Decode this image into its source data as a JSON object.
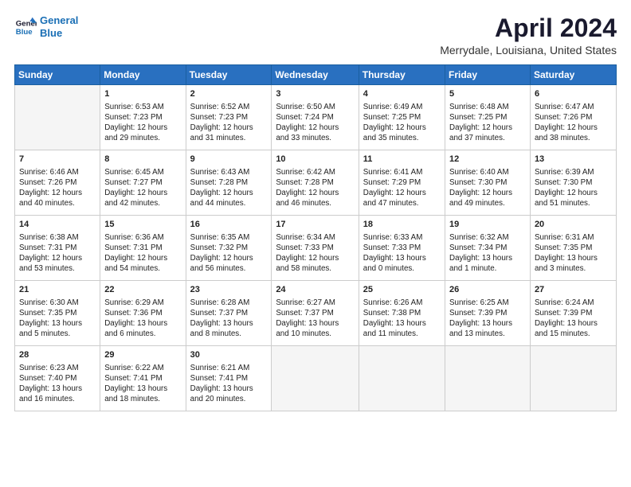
{
  "header": {
    "logo_line1": "General",
    "logo_line2": "Blue",
    "title": "April 2024",
    "subtitle": "Merrydale, Louisiana, United States"
  },
  "weekdays": [
    "Sunday",
    "Monday",
    "Tuesday",
    "Wednesday",
    "Thursday",
    "Friday",
    "Saturday"
  ],
  "weeks": [
    [
      {
        "day": "",
        "info": ""
      },
      {
        "day": "1",
        "info": "Sunrise: 6:53 AM\nSunset: 7:23 PM\nDaylight: 12 hours\nand 29 minutes."
      },
      {
        "day": "2",
        "info": "Sunrise: 6:52 AM\nSunset: 7:23 PM\nDaylight: 12 hours\nand 31 minutes."
      },
      {
        "day": "3",
        "info": "Sunrise: 6:50 AM\nSunset: 7:24 PM\nDaylight: 12 hours\nand 33 minutes."
      },
      {
        "day": "4",
        "info": "Sunrise: 6:49 AM\nSunset: 7:25 PM\nDaylight: 12 hours\nand 35 minutes."
      },
      {
        "day": "5",
        "info": "Sunrise: 6:48 AM\nSunset: 7:25 PM\nDaylight: 12 hours\nand 37 minutes."
      },
      {
        "day": "6",
        "info": "Sunrise: 6:47 AM\nSunset: 7:26 PM\nDaylight: 12 hours\nand 38 minutes."
      }
    ],
    [
      {
        "day": "7",
        "info": "Sunrise: 6:46 AM\nSunset: 7:26 PM\nDaylight: 12 hours\nand 40 minutes."
      },
      {
        "day": "8",
        "info": "Sunrise: 6:45 AM\nSunset: 7:27 PM\nDaylight: 12 hours\nand 42 minutes."
      },
      {
        "day": "9",
        "info": "Sunrise: 6:43 AM\nSunset: 7:28 PM\nDaylight: 12 hours\nand 44 minutes."
      },
      {
        "day": "10",
        "info": "Sunrise: 6:42 AM\nSunset: 7:28 PM\nDaylight: 12 hours\nand 46 minutes."
      },
      {
        "day": "11",
        "info": "Sunrise: 6:41 AM\nSunset: 7:29 PM\nDaylight: 12 hours\nand 47 minutes."
      },
      {
        "day": "12",
        "info": "Sunrise: 6:40 AM\nSunset: 7:30 PM\nDaylight: 12 hours\nand 49 minutes."
      },
      {
        "day": "13",
        "info": "Sunrise: 6:39 AM\nSunset: 7:30 PM\nDaylight: 12 hours\nand 51 minutes."
      }
    ],
    [
      {
        "day": "14",
        "info": "Sunrise: 6:38 AM\nSunset: 7:31 PM\nDaylight: 12 hours\nand 53 minutes."
      },
      {
        "day": "15",
        "info": "Sunrise: 6:36 AM\nSunset: 7:31 PM\nDaylight: 12 hours\nand 54 minutes."
      },
      {
        "day": "16",
        "info": "Sunrise: 6:35 AM\nSunset: 7:32 PM\nDaylight: 12 hours\nand 56 minutes."
      },
      {
        "day": "17",
        "info": "Sunrise: 6:34 AM\nSunset: 7:33 PM\nDaylight: 12 hours\nand 58 minutes."
      },
      {
        "day": "18",
        "info": "Sunrise: 6:33 AM\nSunset: 7:33 PM\nDaylight: 13 hours\nand 0 minutes."
      },
      {
        "day": "19",
        "info": "Sunrise: 6:32 AM\nSunset: 7:34 PM\nDaylight: 13 hours\nand 1 minute."
      },
      {
        "day": "20",
        "info": "Sunrise: 6:31 AM\nSunset: 7:35 PM\nDaylight: 13 hours\nand 3 minutes."
      }
    ],
    [
      {
        "day": "21",
        "info": "Sunrise: 6:30 AM\nSunset: 7:35 PM\nDaylight: 13 hours\nand 5 minutes."
      },
      {
        "day": "22",
        "info": "Sunrise: 6:29 AM\nSunset: 7:36 PM\nDaylight: 13 hours\nand 6 minutes."
      },
      {
        "day": "23",
        "info": "Sunrise: 6:28 AM\nSunset: 7:37 PM\nDaylight: 13 hours\nand 8 minutes."
      },
      {
        "day": "24",
        "info": "Sunrise: 6:27 AM\nSunset: 7:37 PM\nDaylight: 13 hours\nand 10 minutes."
      },
      {
        "day": "25",
        "info": "Sunrise: 6:26 AM\nSunset: 7:38 PM\nDaylight: 13 hours\nand 11 minutes."
      },
      {
        "day": "26",
        "info": "Sunrise: 6:25 AM\nSunset: 7:39 PM\nDaylight: 13 hours\nand 13 minutes."
      },
      {
        "day": "27",
        "info": "Sunrise: 6:24 AM\nSunset: 7:39 PM\nDaylight: 13 hours\nand 15 minutes."
      }
    ],
    [
      {
        "day": "28",
        "info": "Sunrise: 6:23 AM\nSunset: 7:40 PM\nDaylight: 13 hours\nand 16 minutes."
      },
      {
        "day": "29",
        "info": "Sunrise: 6:22 AM\nSunset: 7:41 PM\nDaylight: 13 hours\nand 18 minutes."
      },
      {
        "day": "30",
        "info": "Sunrise: 6:21 AM\nSunset: 7:41 PM\nDaylight: 13 hours\nand 20 minutes."
      },
      {
        "day": "",
        "info": ""
      },
      {
        "day": "",
        "info": ""
      },
      {
        "day": "",
        "info": ""
      },
      {
        "day": "",
        "info": ""
      }
    ]
  ]
}
